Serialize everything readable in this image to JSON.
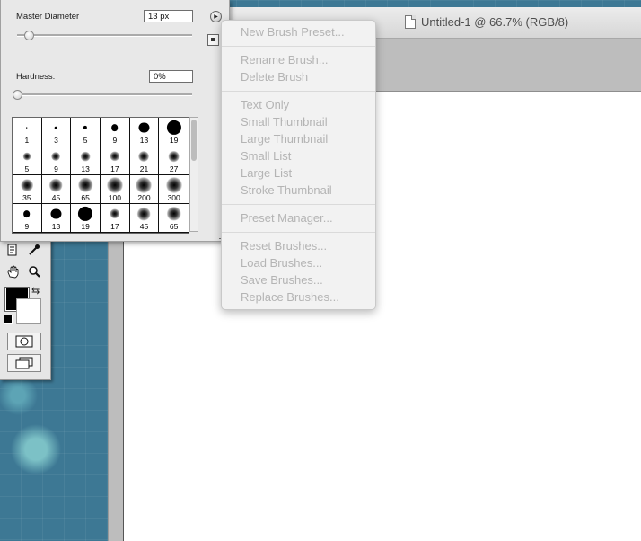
{
  "document": {
    "title": "Untitled-1 @ 66.7% (RGB/8)"
  },
  "brush_panel": {
    "master_diameter_label": "Master Diameter",
    "master_diameter_value": "13 px",
    "hardness_label": "Hardness:",
    "hardness_value": "0%",
    "brushes": [
      {
        "size": "1",
        "soft": false
      },
      {
        "size": "3",
        "soft": false
      },
      {
        "size": "5",
        "soft": false
      },
      {
        "size": "9",
        "soft": false
      },
      {
        "size": "13",
        "soft": false
      },
      {
        "size": "19",
        "soft": false
      },
      {
        "size": "5",
        "soft": true
      },
      {
        "size": "9",
        "soft": true
      },
      {
        "size": "13",
        "soft": true
      },
      {
        "size": "17",
        "soft": true
      },
      {
        "size": "21",
        "soft": true
      },
      {
        "size": "27",
        "soft": true
      },
      {
        "size": "35",
        "soft": true
      },
      {
        "size": "45",
        "soft": true
      },
      {
        "size": "65",
        "soft": true
      },
      {
        "size": "100",
        "soft": true
      },
      {
        "size": "200",
        "soft": true
      },
      {
        "size": "300",
        "soft": true
      },
      {
        "size": "9",
        "soft": false
      },
      {
        "size": "13",
        "soft": false
      },
      {
        "size": "19",
        "soft": false
      },
      {
        "size": "17",
        "soft": true
      },
      {
        "size": "45",
        "soft": true
      },
      {
        "size": "65",
        "soft": true
      }
    ]
  },
  "menu": {
    "items": [
      "New Brush Preset...",
      "Rename Brush...",
      "Delete Brush",
      "Text Only",
      "Small Thumbnail",
      "Large Thumbnail",
      "Small List",
      "Large List",
      "Stroke Thumbnail",
      "Preset Manager...",
      "Reset Brushes...",
      "Load Brushes...",
      "Save Brushes...",
      "Replace Brushes..."
    ]
  },
  "colors": {
    "foreground": "#000000",
    "background": "#ffffff",
    "menu_disabled_text": "#b4b4b4",
    "desktop_blue": "#3d7894"
  },
  "icons": {
    "document": "document-icon",
    "notes": "notes-tool-icon",
    "eyedropper": "eyedropper-tool-icon",
    "hand": "hand-tool-icon",
    "zoom": "zoom-tool-icon",
    "swap": "swap-colors-icon",
    "quick_mask": "quick-mask-icon",
    "screen_mode": "screen-mode-icon",
    "panel_menu": "panel-menu-arrow-icon"
  }
}
